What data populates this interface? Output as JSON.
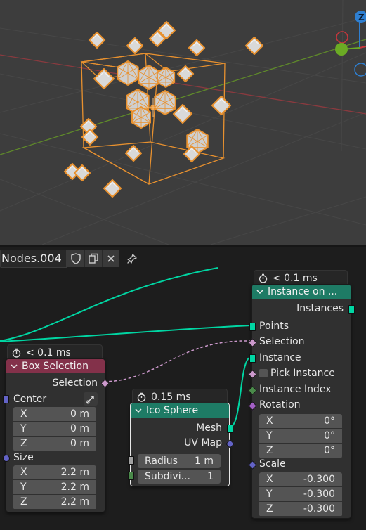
{
  "node_tree": {
    "name": "Nodes.004",
    "shield_icon": "shield-icon",
    "copy_icon": "copy-icon",
    "close_icon": "close-icon",
    "pin_icon": "pin-icon"
  },
  "colors": {
    "viewport_bg": "#3d3d3d",
    "selection_orange": "#e8912f",
    "geometry_link": "#00d6a3",
    "boolean_link": "#cc99cc",
    "input_node_header": "#83314a",
    "geometry_node_header": "#1e7b65",
    "x_axis": "#c8363c",
    "y_axis": "#6bab24",
    "z_axis": "#2e7fd1"
  },
  "viewport": {
    "gizmo_z_label": "Z"
  },
  "nodes": {
    "box_selection": {
      "timing": "< 0.1 ms",
      "title": "Box Selection",
      "output_selection": "Selection",
      "center_label": "Center",
      "center_x_label": "X",
      "center_x": "0 m",
      "center_y_label": "Y",
      "center_y": "0 m",
      "center_z_label": "Z",
      "center_z": "0 m",
      "size_label": "Size",
      "size_x_label": "X",
      "size_x": "2.2 m",
      "size_y_label": "Y",
      "size_y": "2.2 m",
      "size_z_label": "Z",
      "size_z": "2.2 m"
    },
    "ico_sphere": {
      "timing": "0.15 ms",
      "title": "Ico Sphere",
      "output_mesh": "Mesh",
      "output_uvmap": "UV Map",
      "radius_label": "Radius",
      "radius": "1 m",
      "subdiv_label": "Subdivi...",
      "subdiv": "1"
    },
    "instance_on_points": {
      "timing": "< 0.1 ms",
      "title": "Instance on ...",
      "output_instances": "Instances",
      "input_points": "Points",
      "input_selection": "Selection",
      "input_instance": "Instance",
      "input_pick_instance": "Pick Instance",
      "input_instance_index": "Instance Index",
      "input_rotation": "Rotation",
      "rot_x_label": "X",
      "rot_x": "0°",
      "rot_y_label": "Y",
      "rot_y": "0°",
      "rot_z_label": "Z",
      "rot_z": "0°",
      "input_scale": "Scale",
      "scale_x_label": "X",
      "scale_x": "-0.300",
      "scale_y_label": "Y",
      "scale_y": "-0.300",
      "scale_z_label": "Z",
      "scale_z": "-0.300"
    }
  }
}
